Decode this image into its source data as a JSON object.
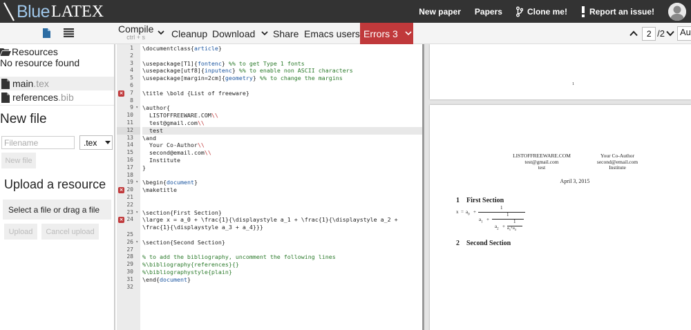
{
  "topbar": {
    "logo_blue": "Blue",
    "logo_latex": "LATEX",
    "links": [
      {
        "label": "New paper"
      },
      {
        "label": "Papers"
      },
      {
        "label": "Clone me!"
      },
      {
        "label": "Report an issue!"
      }
    ]
  },
  "toolbar": {
    "compile_label": "Compile",
    "compile_shortcut": "ctrl + s",
    "cleanup": "Cleanup",
    "download": "Download",
    "share": "Share",
    "emacs": "Emacs users",
    "errors": "Errors 3",
    "page_current": "2",
    "page_total": "/2",
    "zoom": "Auto"
  },
  "sidebar": {
    "resources_title": "Resources",
    "no_resource": "No resource found",
    "files": [
      {
        "name": "main",
        "ext": ".tex"
      },
      {
        "name": "references",
        "ext": ".bib"
      }
    ],
    "new_file_title": "New file",
    "filename_placeholder": "Filename",
    "ext_option": ".tex",
    "new_file_btn": "New file",
    "upload_title": "Upload a resource",
    "dropzone": "Select a file or drag a file",
    "upload_btn": "Upload",
    "cancel_upload_btn": "Cancel upload"
  },
  "editor": {
    "lines": [
      {
        "n": "1",
        "text": "\\documentclass{article}"
      },
      {
        "n": "2",
        "text": ""
      },
      {
        "n": "3",
        "text": "\\usepackage[T1]{fontenc} %% to get Type 1 fonts"
      },
      {
        "n": "4",
        "text": "\\usepackage[utf8]{inputenc} %% to enable non ASCII characters"
      },
      {
        "n": "5",
        "text": "\\usepackage[margin=2cm]{geometry} %% to change the margins"
      },
      {
        "n": "6",
        "text": ""
      },
      {
        "n": "7",
        "text": "\\title \\bold {List of freeware}"
      },
      {
        "n": "8",
        "text": ""
      },
      {
        "n": "9",
        "text": "\\author{"
      },
      {
        "n": "10",
        "text": "  LISTOFFREEWARE.COM\\\\"
      },
      {
        "n": "11",
        "text": "  test@gmail.com\\\\"
      },
      {
        "n": "12",
        "text": "  test"
      },
      {
        "n": "13",
        "text": "\\and"
      },
      {
        "n": "14",
        "text": "  Your Co-Author\\\\"
      },
      {
        "n": "15",
        "text": "  second@email.com\\\\"
      },
      {
        "n": "16",
        "text": "  Institute"
      },
      {
        "n": "17",
        "text": "}"
      },
      {
        "n": "18",
        "text": ""
      },
      {
        "n": "19",
        "text": "\\begin{document}"
      },
      {
        "n": "20",
        "text": "\\maketitle"
      },
      {
        "n": "21",
        "text": ""
      },
      {
        "n": "22",
        "text": ""
      },
      {
        "n": "23",
        "text": "\\section{First Section}"
      },
      {
        "n": "24",
        "text": "\\large x = a_0 + \\frac{1}{\\displaystyle a_1 + \\frac{1}{\\displaystyle a_2 +"
      },
      {
        "n": "",
        "text": "\\frac{1}{\\displaystyle a_3 + a_4}}}"
      },
      {
        "n": "25",
        "text": ""
      },
      {
        "n": "26",
        "text": "\\section{Second Section}"
      },
      {
        "n": "27",
        "text": ""
      },
      {
        "n": "28",
        "text": "% to add the bibliography, uncomment the following lines"
      },
      {
        "n": "29",
        "text": "%\\bibliography{references}{}"
      },
      {
        "n": "30",
        "text": "%\\bibliographystyle{plain}"
      },
      {
        "n": "31",
        "text": "\\end{document}"
      },
      {
        "n": "32",
        "text": ""
      }
    ]
  },
  "viewer": {
    "page1_number": "1",
    "author1": [
      "LISTOFFREEWARE.COM",
      "test@gmail.com",
      "test"
    ],
    "author2": [
      "Your Co-Author",
      "second@email.com",
      "Institute"
    ],
    "date": "April 3, 2015",
    "section1_num": "1",
    "section1": "First Section",
    "section2_num": "2",
    "section2": "Second Section",
    "formula": {
      "x": "x",
      "eq": "=",
      "a0": "a",
      "a0_sub": "0",
      "plus": "+",
      "one": "1",
      "a1": "a",
      "a1_sub": "1",
      "a2": "a",
      "a2_sub": "2",
      "a3": "a",
      "a3_sub": "3",
      "a4": "a",
      "a4_sub": "4"
    }
  }
}
